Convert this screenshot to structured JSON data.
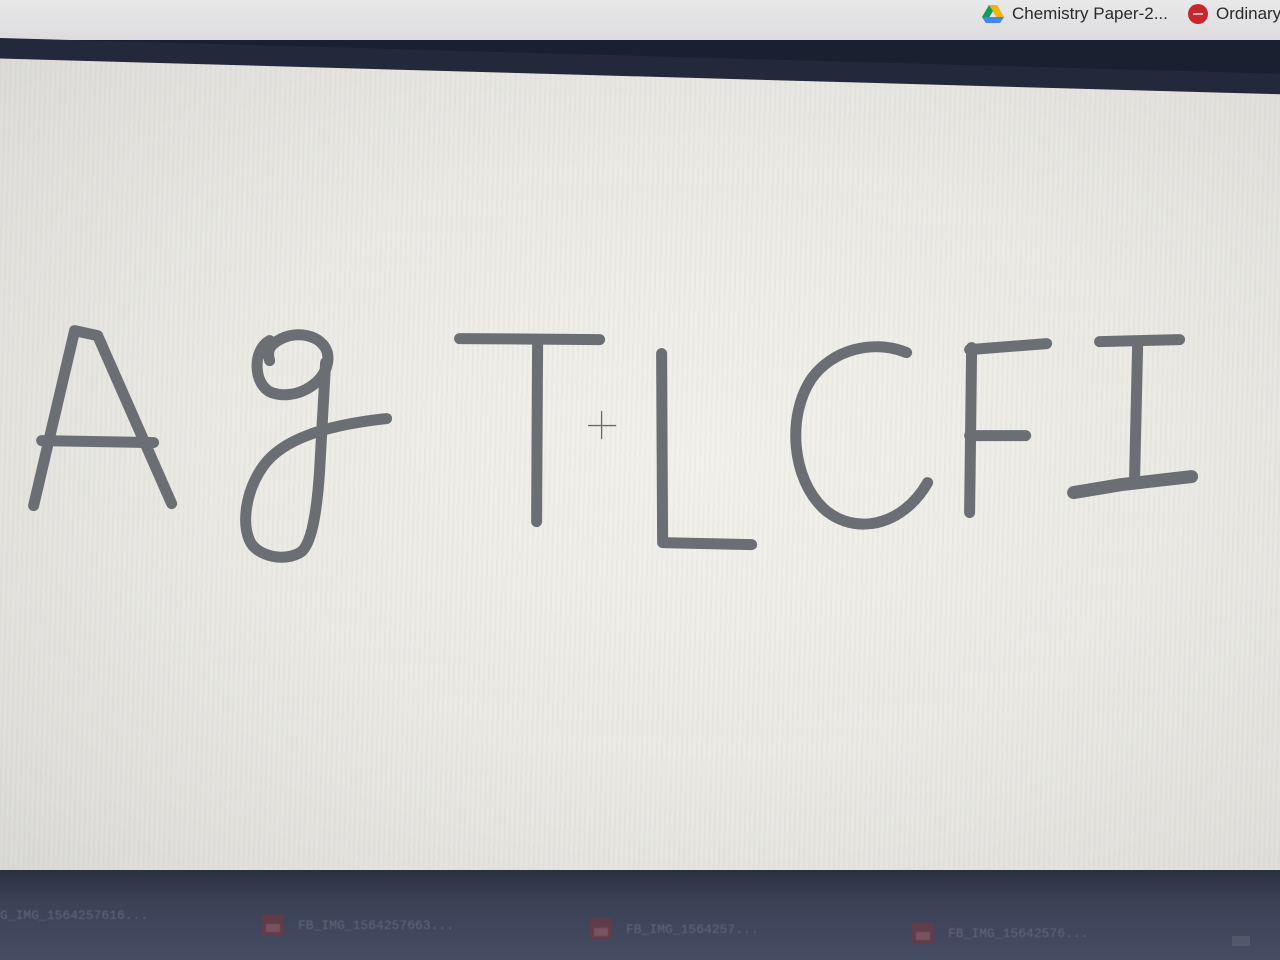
{
  "browser": {
    "bookmarks": [
      {
        "label": "Chemistry Paper-2...",
        "icon": "google-drive-icon"
      },
      {
        "label": "Ordinary",
        "icon": "red-circle-icon"
      }
    ]
  },
  "canvas": {
    "handwritten_text": "Ag TLCFI",
    "cursor": "crosshair-cursor-icon",
    "stroke_color": "#6b6f74",
    "background_color": "#eceae5"
  },
  "taskbar": {
    "items": [
      {
        "label": "G_IMG_1564257616...",
        "icon": "image-file-icon"
      },
      {
        "label": "FB_IMG_1564257663...",
        "icon": "image-file-icon"
      },
      {
        "label": "FB_IMG_1564257...",
        "icon": "image-file-icon"
      },
      {
        "label": "FB_IMG_15642576...",
        "icon": "image-file-icon"
      }
    ]
  }
}
